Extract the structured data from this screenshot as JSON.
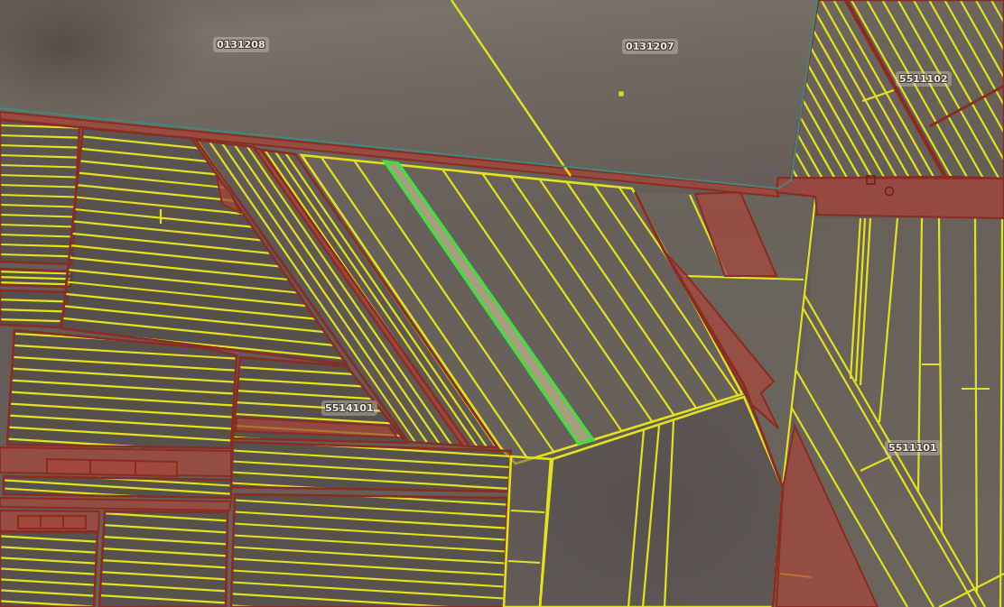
{
  "map": {
    "parcel_labels": [
      {
        "text": "0131208"
      },
      {
        "text": "0131207"
      },
      {
        "text": "5511102"
      },
      {
        "text": "5514101"
      },
      {
        "text": "5511101"
      }
    ],
    "highlighted_parcel": true
  }
}
